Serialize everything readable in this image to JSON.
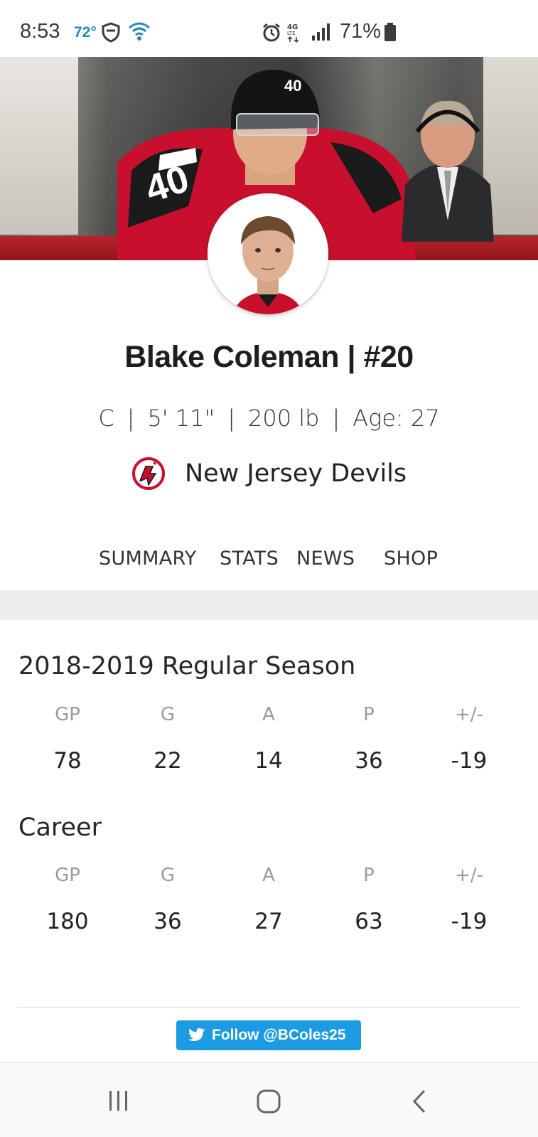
{
  "status_bar": {
    "time": "8:53",
    "temperature": "72°",
    "battery": "71%",
    "network": "4G LTE"
  },
  "player": {
    "name": "Blake Coleman | #20",
    "position": "C",
    "height": "5' 11\"",
    "weight": "200 lb",
    "age": "Age: 27",
    "team": "New Jersey Devils",
    "separator": "|"
  },
  "tabs": [
    {
      "label": "SUMMARY"
    },
    {
      "label": "STATS"
    },
    {
      "label": "NEWS"
    },
    {
      "label": "SHOP"
    }
  ],
  "season": {
    "title": "2018-2019 Regular Season",
    "headers": [
      "GP",
      "G",
      "A",
      "P",
      "+/-"
    ],
    "values": [
      "78",
      "22",
      "14",
      "36",
      "-19"
    ]
  },
  "career": {
    "title": "Career",
    "headers": [
      "GP",
      "G",
      "A",
      "P",
      "+/-"
    ],
    "values": [
      "180",
      "36",
      "27",
      "63",
      "-19"
    ]
  },
  "follow": {
    "label": "Follow @BColes25",
    "icon": "twitter-bird-icon"
  },
  "colors": {
    "accent_twitter": "#1d9be2",
    "devils_red": "#c8102e"
  },
  "nav": {
    "recents_icon": "recents-icon",
    "home_icon": "home-icon",
    "back_icon": "back-icon"
  }
}
